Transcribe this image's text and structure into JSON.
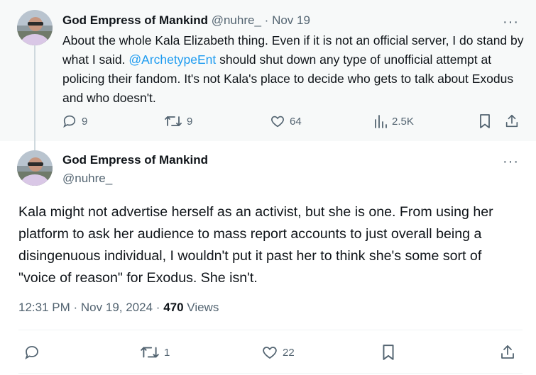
{
  "tweet1": {
    "author_name": "God Empress of Mankind",
    "handle": "@nuhre_",
    "separator": "·",
    "date": "Nov 19",
    "text_before": "About the whole Kala Elizabeth thing. Even if it is not an official server, I do stand by what I said. ",
    "mention": "@ArchetypeEnt",
    "text_after": "  should shut down any type of unofficial attempt at policing their fandom. It's not Kala's place to decide who gets to talk about Exodus and who doesn't.",
    "replies": "9",
    "reposts": "9",
    "likes": "64",
    "views": "2.5K"
  },
  "tweet2": {
    "author_name": "God Empress of Mankind",
    "handle": "@nuhre_",
    "text": "Kala might not advertise herself as an activist, but she is one. From using her platform to ask her audience to mass report accounts to just overall being a disingenuous individual, I wouldn't put it past her to think she's some sort of \"voice of reason\" for Exodus. She isn't.",
    "time": "12:31 PM",
    "separator": "·",
    "date": "Nov 19, 2024",
    "separator2": "·",
    "views_count": "470",
    "views_label": "Views",
    "reposts": "1",
    "likes": "22"
  },
  "more_label": "···",
  "colors": {
    "accent": "#1d9bf0",
    "muted": "#536471",
    "text": "#0f1419",
    "thread_line": "#cfd9de"
  },
  "icons": [
    "reply-icon",
    "repost-icon",
    "like-icon",
    "views-icon",
    "bookmark-icon",
    "share-icon",
    "more-icon"
  ]
}
